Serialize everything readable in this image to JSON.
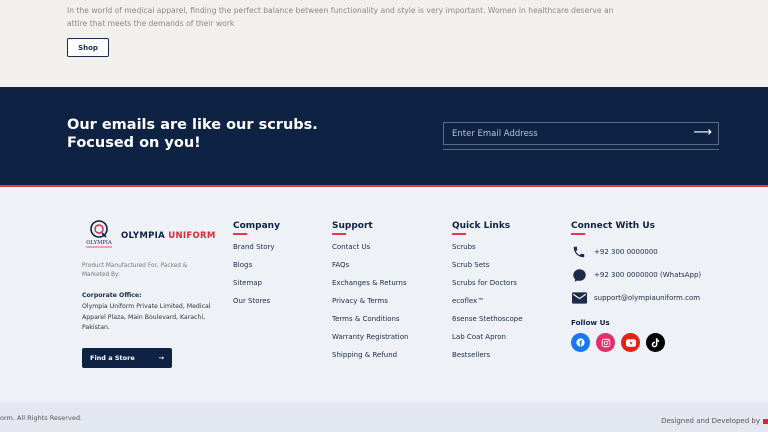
{
  "intro": {
    "text": "In the world of medical apparel, finding the perfect balance between functionality and style is very important. Women in healthcare deserve an attire that meets the demands of their work",
    "shop_label": "Shop"
  },
  "newsletter": {
    "headline_line1": "Our emails are like our scrubs.",
    "headline_line2": "Focused on you!",
    "placeholder": "Enter Email Address",
    "submit_arrow": "⟶"
  },
  "brand": {
    "logo_mark_text": "OLYMPIA",
    "name_part1": "OLYMPIA",
    "name_part2": "UNIFORM",
    "mfg_note": "Product Manufactured For, Packed & Marketed By:",
    "corp_title": "Corporate Office:",
    "corp_address": "Olympia Uniform Private Limited, Medical Apparel Plaza, Main Boulevard, Karachi, Pakistan.",
    "find_store_label": "Find a Store",
    "find_store_arrow": "→"
  },
  "columns": {
    "company": {
      "title": "Company",
      "items": [
        "Brand Story",
        "Blogs",
        "Sitemap",
        "Our Stores"
      ]
    },
    "support": {
      "title": "Support",
      "items": [
        "Contact Us",
        "FAQs",
        "Exchanges & Returns",
        "Privacy & Terms",
        "Terms & Conditions",
        "Warranty Registration",
        "Shipping & Refund"
      ]
    },
    "quick_links": {
      "title": "Quick Links",
      "items": [
        "Scrubs",
        "Scrub Sets",
        "Scrubs for Doctors",
        "ecoflex™",
        "6sense Stethoscope",
        "Lab Coat Apron",
        "Bestsellers"
      ]
    },
    "connect": {
      "title": "Connect With Us",
      "phone": "+92 300 0000000",
      "whatsapp": "+92 300 0000000 (WhatsApp)",
      "email": "support@olympiauniform.com",
      "icons": [
        "phone-icon",
        "whatsapp-icon",
        "email-icon"
      ]
    }
  },
  "social": {
    "title": "Follow Us",
    "icons": [
      "facebook-icon",
      "instagram-icon",
      "youtube-icon",
      "tiktok-icon"
    ],
    "colors": {
      "facebook": "#1877f2",
      "instagram": "#e1306c",
      "youtube": "#e62117",
      "tiktok": "#000000"
    }
  },
  "bottom": {
    "copyright": "orm. All Rights Reserved.",
    "designed_by": "Designed and Developed by"
  },
  "colors": {
    "navy": "#0e2244",
    "accent_red": "#e23a4a",
    "footer_bg": "#eef1f6"
  }
}
